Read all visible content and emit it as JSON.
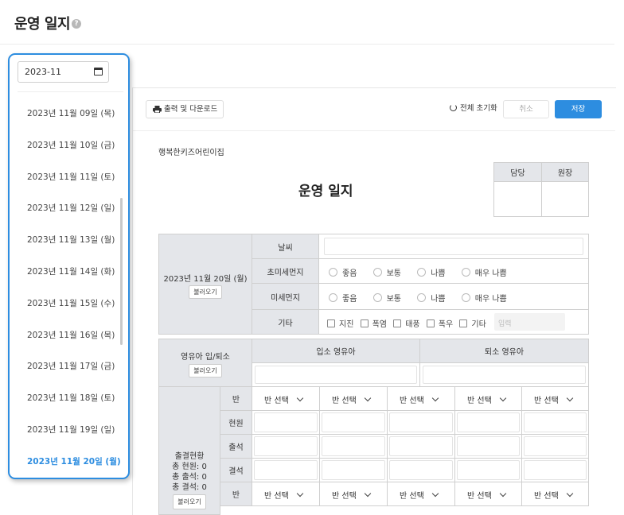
{
  "page": {
    "title": "운영 일지",
    "help_icon": "?"
  },
  "date_panel": {
    "month_value": "2023-11",
    "dates": [
      "2023년 11월 09일 (목)",
      "2023년 11월 10일 (금)",
      "2023년 11월 11일 (토)",
      "2023년 11월 12일 (일)",
      "2023년 11월 13일 (월)",
      "2023년 11월 14일 (화)",
      "2023년 11월 15일 (수)",
      "2023년 11월 16일 (목)",
      "2023년 11월 17일 (금)",
      "2023년 11월 18일 (토)",
      "2023년 11월 19일 (일)",
      "2023년 11월 20일 (월)"
    ],
    "selected": "2023년 11월 20일 (월)"
  },
  "toolbar": {
    "print_label": "출력 및 다운로드",
    "reset_label": "전체 초기화",
    "cancel_label": "취소",
    "save_label": "저장"
  },
  "document": {
    "org_name": "행복한키즈어린이집",
    "title": "운영 일지",
    "approval": {
      "manager": "담당",
      "director": "원장"
    },
    "date_label": "2023년 11월 20일 (월)",
    "load_label": "불러오기",
    "weather": {
      "label": "날씨"
    },
    "ultrafine_dust": {
      "label": "초미세먼지",
      "options": [
        "좋음",
        "보통",
        "나쁨",
        "매우 나쁨"
      ]
    },
    "fine_dust": {
      "label": "미세먼지",
      "options": [
        "좋음",
        "보통",
        "나쁨",
        "매우 나쁨"
      ]
    },
    "other": {
      "label": "기타",
      "options": [
        "지진",
        "폭염",
        "태풍",
        "폭우",
        "기타"
      ],
      "placeholder": "입력"
    },
    "children_inout": {
      "label": "영유아 입/퇴소",
      "entry": "입소 영유아",
      "exit": "퇴소 영유아"
    },
    "attendance": {
      "label": "출결현황",
      "total_enrolled": "총 현원: 0",
      "total_present": "총 출석: 0",
      "total_absent": "총 결석: 0",
      "rows": [
        "반",
        "현원",
        "출석",
        "결석",
        "반"
      ],
      "class_select": "반 선택"
    }
  },
  "colors": {
    "accent": "#2d8de0",
    "header_gray": "#e4e6ea"
  }
}
